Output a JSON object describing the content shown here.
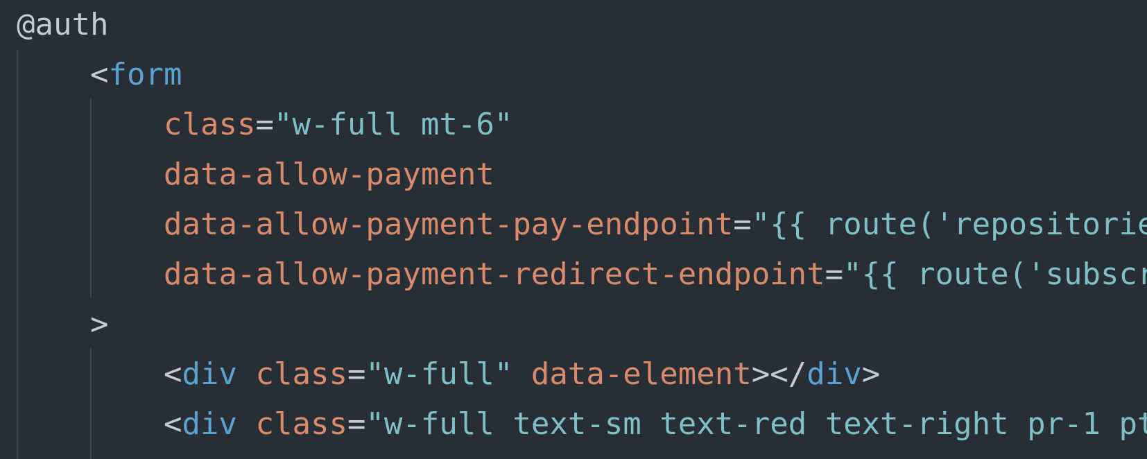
{
  "colors": {
    "background": "#282e36",
    "default_text": "#c7ccd4",
    "tag": "#5aa3d3",
    "attribute": "#d98a6b",
    "string": "#7fbfc7",
    "indent_guide": "#3e454f"
  },
  "code": {
    "l1": {
      "directive": "@auth"
    },
    "l2": {
      "open_bracket": "<",
      "tag": "form"
    },
    "l3": {
      "attr": "class",
      "eq": "=",
      "value": "\"w-full mt-6\""
    },
    "l4": {
      "attr": "data-allow-payment"
    },
    "l5": {
      "attr": "data-allow-payment-pay-endpoint",
      "eq": "=",
      "value": "\"{{ route('repositorie"
    },
    "l6": {
      "attr": "data-allow-payment-redirect-endpoint",
      "eq": "=",
      "value": "\"{{ route('subscr"
    },
    "l7": {
      "close_bracket": ">"
    },
    "l8": {
      "open_bracket": "<",
      "tag": "div",
      "space": " ",
      "attr_class": "class",
      "eq": "=",
      "value": "\"w-full\"",
      "space2": " ",
      "attr_data": "data-element",
      "mid": "></",
      "close_tag": "div",
      "end": ">"
    },
    "l9": {
      "open_bracket": "<",
      "tag": "div",
      "space": " ",
      "attr_class": "class",
      "eq": "=",
      "value": "\"w-full text-sm text-red text-right pr-1 pt"
    }
  }
}
